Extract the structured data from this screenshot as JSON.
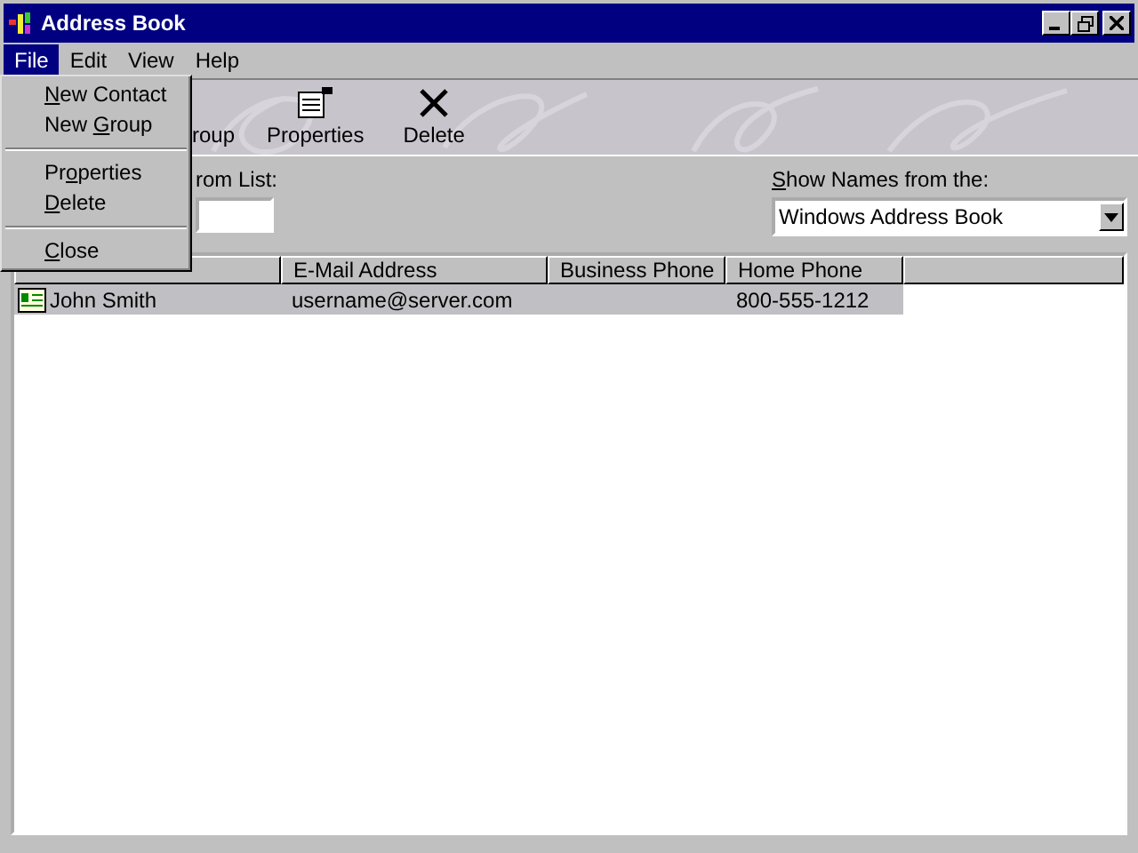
{
  "window": {
    "title": "Address Book"
  },
  "menu_bar": [
    {
      "label": "File",
      "selected": true
    },
    {
      "label": "Edit",
      "selected": false
    },
    {
      "label": "View",
      "selected": false
    },
    {
      "label": "Help",
      "selected": false
    }
  ],
  "file_menu": [
    [
      {
        "key": "N",
        "post": "ew Contact"
      },
      {
        "pre": "New ",
        "key": "G",
        "post": "roup"
      }
    ],
    [
      {
        "pre": "Pr",
        "key": "o",
        "post": "perties"
      },
      {
        "key": "D",
        "post": "elete"
      }
    ],
    [
      {
        "key": "C",
        "post": "lose"
      }
    ]
  ],
  "toolbar": [
    {
      "label": "roup",
      "kind": "partial"
    },
    {
      "label": "Properties",
      "kind": "properties"
    },
    {
      "label": "Delete",
      "kind": "delete"
    }
  ],
  "search": {
    "label": "rom List:"
  },
  "source": {
    "label_key": "S",
    "label_post": "how Names from the:",
    "value": "Windows Address Book"
  },
  "table": {
    "columns": [
      "",
      "E-Mail Address",
      "Business Phone",
      "Home Phone",
      ""
    ],
    "rows": [
      {
        "cells": [
          "John Smith",
          "username@server.com",
          "",
          "800-555-1212"
        ],
        "selected": true
      }
    ]
  }
}
